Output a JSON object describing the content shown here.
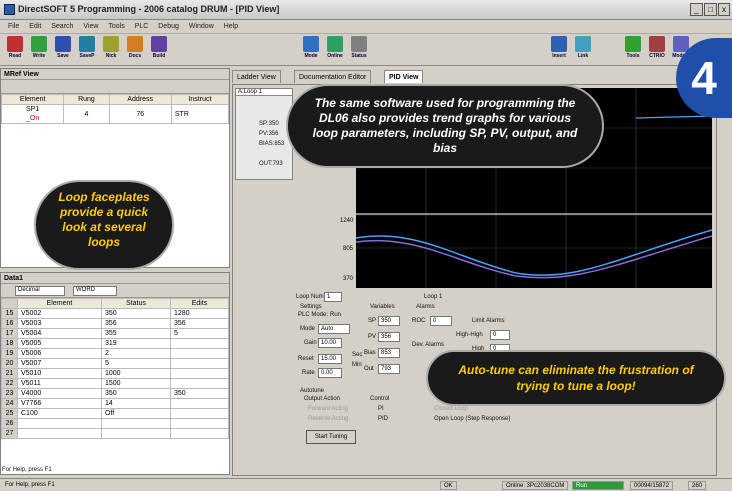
{
  "window": {
    "title": "DirectSOFT 5 Programming - 2006 catalog DRUM - [PID View]"
  },
  "menu": [
    "File",
    "Edit",
    "Search",
    "View",
    "Tools",
    "PLC",
    "Debug",
    "Window",
    "Help"
  ],
  "toolbar": [
    "Read",
    "Write",
    "Save",
    "SaveP",
    "Nick",
    "Docs",
    "Build",
    "Mode",
    "Online",
    "Status",
    "Insert",
    "Link",
    "Tools",
    "CTRIO",
    "Module"
  ],
  "mref": {
    "title": "MRef View",
    "headers": [
      "Element",
      "Rung",
      "Address",
      "Instruct"
    ],
    "row": {
      "element": "SP1",
      "sub": "_On",
      "rung": "4",
      "address": "76",
      "instruct": "STR"
    }
  },
  "tabs": [
    "Ladder View",
    "Documentation Editor",
    "PID View"
  ],
  "faceplate": {
    "label": "A:Loop 1",
    "sp": "SP:350",
    "pv": "PV:356",
    "bias": "BIAS:853",
    "out": "OUT:793"
  },
  "graph": {
    "y_ticks": [
      "1240",
      "805",
      "370"
    ],
    "y_upper": "1500"
  },
  "data_view": {
    "title": "Data1",
    "format": "Decimal",
    "type": "WORD",
    "headers": [
      "Element",
      "Status",
      "Edits"
    ],
    "rows": [
      {
        "n": "15",
        "el": "V5002",
        "st": "350",
        "ed": "1280"
      },
      {
        "n": "16",
        "el": "V5003",
        "st": "356",
        "ed": "356"
      },
      {
        "n": "17",
        "el": "V5004",
        "st": "355",
        "ed": "5"
      },
      {
        "n": "18",
        "el": "V5005",
        "st": "319",
        "ed": ""
      },
      {
        "n": "19",
        "el": "V5006",
        "st": "2",
        "ed": ""
      },
      {
        "n": "20",
        "el": "V5007",
        "st": "5",
        "ed": ""
      },
      {
        "n": "21",
        "el": "V5010",
        "st": "1000",
        "ed": ""
      },
      {
        "n": "22",
        "el": "V5011",
        "st": "1500",
        "ed": ""
      },
      {
        "n": "23",
        "el": "V4000",
        "st": "350",
        "ed": "350"
      },
      {
        "n": "24",
        "el": "V7766",
        "st": "14",
        "ed": ""
      },
      {
        "n": "25",
        "el": "C100",
        "st": "Off",
        "ed": ""
      },
      {
        "n": "26",
        "el": "",
        "st": "",
        "ed": ""
      },
      {
        "n": "27",
        "el": "",
        "st": "",
        "ed": ""
      }
    ]
  },
  "pid": {
    "loop_num_label": "Loop Num:",
    "loop_num": "1",
    "loop_title": "Loop 1",
    "settings": "Settings",
    "plc_mode": "PLC Mode:",
    "plc_mode_val": "Run",
    "mode_label": "Mode",
    "mode_val": "Auto",
    "gain_label": "Gain",
    "gain_val": "10.00",
    "reset_label": "Reset",
    "reset_val": "15.00",
    "rate_label": "Rate",
    "rate_val": "0.00",
    "sec": "Sec",
    "min": "Min",
    "variables": "Variables",
    "sp_label": "SP",
    "sp_val": "350",
    "pv_label": "PV",
    "pv_val": "356",
    "bias_label": "Bias",
    "bias_val": "853",
    "out_label": "Out",
    "out_val": "793",
    "alarms": "Alarms",
    "roc": "ROC",
    "roc_val": "0",
    "limit_alarms": "Limit Alarms",
    "high_high": "High-High",
    "high_high_val": "0",
    "high": "High",
    "high_val": "0",
    "dev_alarms": "Dev. Alarms",
    "autotune": "Autotune",
    "output_action": "Output Action",
    "forward": "Forward Acting",
    "reverse": "Reverse Acting",
    "control": "Control",
    "pi": "PI",
    "pid": "PID",
    "closed_loop": "Closed Loop",
    "open_loop": "Open Loop (Step Response)",
    "start_tuning": "Start Tuning"
  },
  "status": {
    "help1": "For Help, press F1",
    "help2": "For Help, press F1",
    "ok": "OK",
    "online": "Online: 3Pc2038COM",
    "run": "Run",
    "mem": "00094/15872",
    "num": "260"
  },
  "callouts": {
    "top": "The same software used for programming the DL06 also provides trend graphs for various loop parameters, including SP, PV, output, and bias",
    "left": "Loop faceplates provide a quick look at several loops",
    "bottom": "Auto-tune can eliminate the frustration of trying to tune a loop!",
    "badge": "4"
  },
  "colors": {
    "sp_line": "#4aa0ff",
    "pv_line": "#3fbf7f",
    "out_line": "#8a6cd8",
    "badge": "#1f4fa8"
  }
}
